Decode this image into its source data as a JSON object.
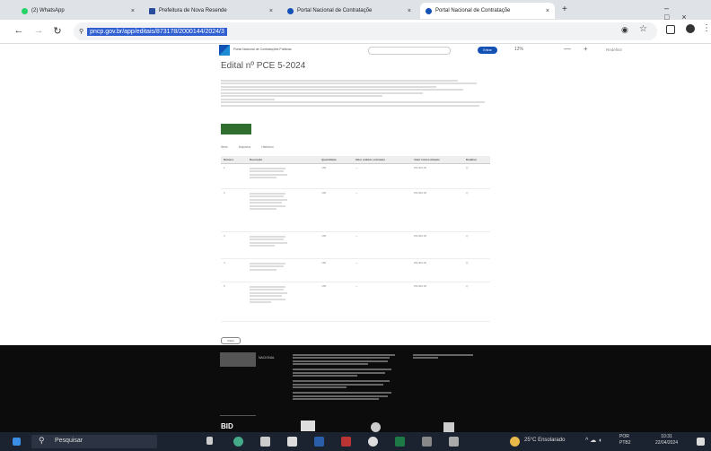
{
  "browser": {
    "tabs": [
      {
        "label": "(2) WhatsApp",
        "favicon_color": "#25d366",
        "active": false
      },
      {
        "label": "Prefeitura de Nova Resende",
        "favicon_color": "#2a4d9b",
        "active": false
      },
      {
        "label": "Portal Nacional de Contrataçõe",
        "favicon_color": "#1351b4",
        "active": false
      },
      {
        "label": "Portal Nacional de Contrataçõe",
        "favicon_color": "#1351b4",
        "active": true
      }
    ],
    "url": "pncp.gov.br/app/editais/873178/2000144/2024/3",
    "new_tab_symbol": "+"
  },
  "page": {
    "portal_name": "Portal Nacional de Contratações Públicas",
    "title": "Edital nº PCE 5-2024",
    "entrar_label": "Entrar",
    "zoom_options": "12%",
    "tabs": [
      "Itens",
      "Arquivos",
      "Histórico"
    ],
    "table_headers": [
      "Número",
      "Descrição",
      "Quantidade",
      "Valor unitário estimado",
      "Valor total estimado",
      "Detalhar"
    ],
    "rows": [
      {
        "num": "1",
        "qty": "150",
        "unit": "—",
        "total": "R$ 000,00"
      },
      {
        "num": "2",
        "qty": "100",
        "unit": "—",
        "total": "R$ 000,00"
      },
      {
        "num": "3",
        "qty": "150",
        "unit": "—",
        "total": "R$ 000,00"
      },
      {
        "num": "4",
        "qty": "150",
        "unit": "—",
        "total": "R$ 000,00"
      },
      {
        "num": "5",
        "qty": "150",
        "unit": "—",
        "total": "R$ 000,00"
      }
    ],
    "back_button": "Voltar"
  },
  "footer": {
    "logo_text": "NACIONAL",
    "bottom_logo": "BID"
  },
  "taskbar": {
    "search_placeholder": "Pesquisar",
    "weather": "25°C Ensolarado",
    "lang": "POR",
    "lang2": "PTB2",
    "time": "10:31",
    "date": "22/04/2024"
  }
}
